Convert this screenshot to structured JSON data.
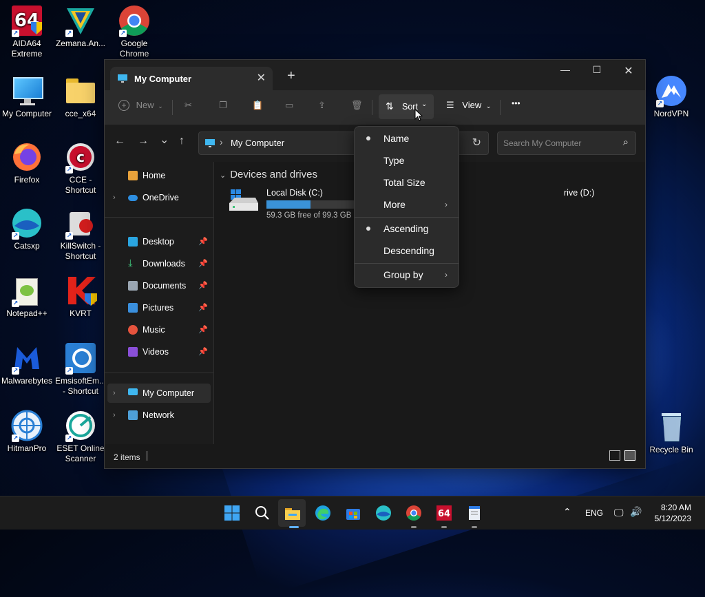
{
  "desktop": {
    "icons": [
      {
        "label": "AIDA64\nExtreme"
      },
      {
        "label": "Zemana.An..."
      },
      {
        "label": "Google\nChrome"
      },
      {
        "label": "My Computer"
      },
      {
        "label": "cce_x64"
      },
      {
        "label": "Firefox"
      },
      {
        "label": "CCE -\nShortcut"
      },
      {
        "label": "Catsxp"
      },
      {
        "label": "KillSwitch -\nShortcut"
      },
      {
        "label": "Notepad++"
      },
      {
        "label": "KVRT"
      },
      {
        "label": "Malwarebytes"
      },
      {
        "label": "EmsisoftEm...\n- Shortcut"
      },
      {
        "label": "HitmanPro"
      },
      {
        "label": "ESET Online\nScanner"
      },
      {
        "label": "NordVPN"
      },
      {
        "label": "Recycle Bin"
      }
    ]
  },
  "window": {
    "tab_title": "My Computer",
    "tab_close": "✕",
    "new_tab": "+",
    "minimize": "—",
    "maximize": "☐",
    "close": "✕"
  },
  "toolbar": {
    "new_label": "New",
    "sort_label": "Sort",
    "view_label": "View",
    "more_label": "•••"
  },
  "nav": {
    "back": "←",
    "forward": "→",
    "recent": "⌄",
    "up": "↑",
    "breadcrumb_sep": "›",
    "address": "My Computer",
    "search_placeholder": "Search My Computer"
  },
  "sidebar": {
    "home": "Home",
    "onedrive": "OneDrive",
    "quick": [
      {
        "label": "Desktop"
      },
      {
        "label": "Downloads"
      },
      {
        "label": "Documents"
      },
      {
        "label": "Pictures"
      },
      {
        "label": "Music"
      },
      {
        "label": "Videos"
      }
    ],
    "my_computer": "My Computer",
    "network": "Network"
  },
  "content": {
    "group_header": "Devices and drives",
    "drives": [
      {
        "name": "Local Disk (C:)",
        "free": "59.3 GB free of 99.3 GB",
        "used_fraction": 0.4
      },
      {
        "name": "rive (D:)"
      }
    ]
  },
  "status": {
    "items": "2 items"
  },
  "sort_menu": {
    "items": [
      {
        "label": "Name",
        "checked": true
      },
      {
        "label": "Type",
        "checked": false
      },
      {
        "label": "Total Size",
        "checked": false
      },
      {
        "label": "More",
        "submenu": true
      },
      {
        "label": "Ascending",
        "checked": true
      },
      {
        "label": "Descending",
        "checked": false
      },
      {
        "label": "Group by",
        "submenu": true
      }
    ]
  },
  "taskbar": {
    "lang": "ENG",
    "time": "8:20 AM",
    "date": "5/12/2023"
  },
  "colors": {
    "accent": "#3a92d8",
    "window_bg": "#202020",
    "menu_bg": "#2b2b2b"
  }
}
